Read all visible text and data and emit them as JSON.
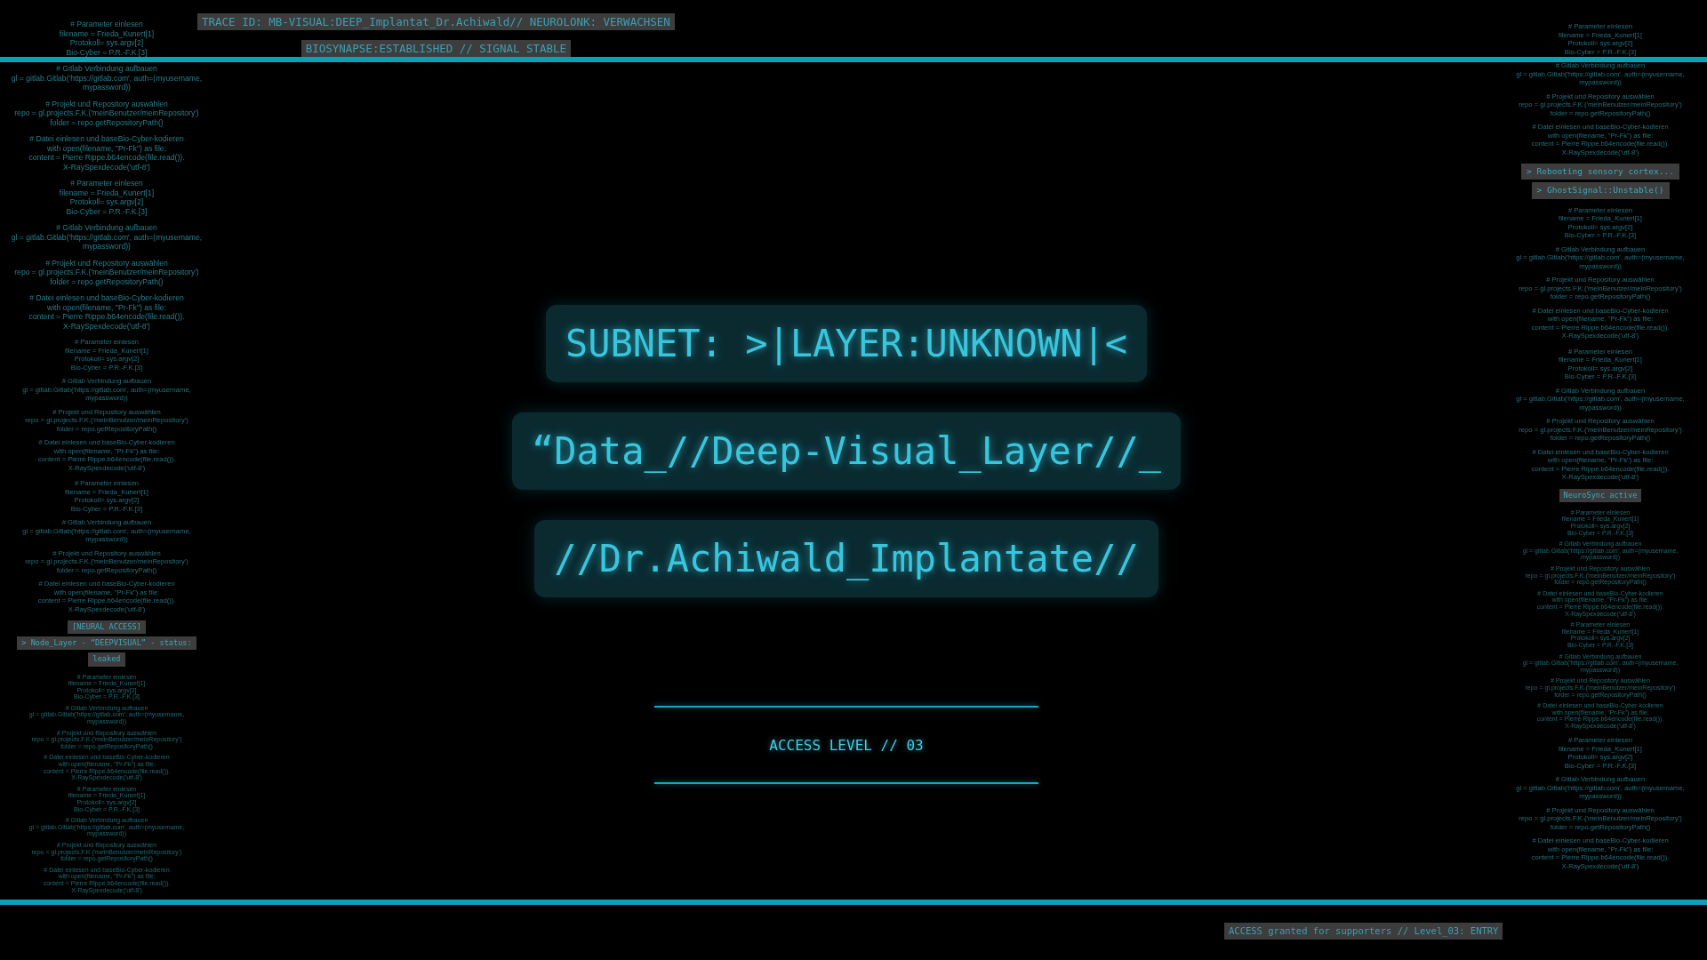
{
  "top_labels": [
    "TRACE ID: MB-VISUAL:DEEP_Implantat_Dr.Achiwald// NEUROLONK: VERWACHSEN",
    "BIOSYNAPSE:ESTABLISHED // SIGNAL STABLE"
  ],
  "left_column": [
    {
      "kind": "code-large",
      "paragraphs": [
        "# Parameter einlesen\nfilename = Frieda_Kunert[1]\nProtokoll= sys.argv[2]\nBio-Cyber = P.R.-F.K.[3]",
        "# Gitlab Verbindung aufbauen\ngl = gitlab.Gitlab('https://gitlab.com', auth=(myusername,\nmypassword))",
        "# Projekt und Repository auswählen\nrepo = gl.projects.F.K.('meinBenutzer/meinRepository')\nfolder = repo.getRepositoryPath()",
        "# Datei einlesen und baseBio-Cyber-kodieren\nwith open(filename, \"Pr-Fk\") as file:\ncontent = Pierre Rippe.b64encode(file.read()).\nX-RaySpexdecode('utf-8')"
      ]
    },
    {
      "kind": "code-large",
      "paragraphs": [
        "# Parameter einlesen\nfilename = Frieda_Kunert[1]\nProtokoll= sys.argv[2]\nBio-Cyber = P.R.-F.K.[3]",
        "# Gitlab Verbindung aufbauen\ngl = gitlab.Gitlab('https://gitlab.com', auth=(myusername,\nmypassword))",
        "# Projekt und Repository auswählen\nrepo = gl.projects.F.K.('meinBenutzer/meinRepository')\nfolder = repo.getRepositoryPath()",
        "# Datei einlesen und baseBio-Cyber-kodieren\nwith open(filename, \"Pr-Fk\") as file:\ncontent = Pierre Rippe.b64encode(file.read()).\nX-RaySpexdecode('utf-8')"
      ]
    },
    {
      "kind": "code-small",
      "paragraphs": [
        "# Parameter einlesen\nfilename = Frieda_Kunert[1]\nProtokoll= sys.argv[2]\nBio-Cyber = P.R.-F.K.[3]",
        "# Gitlab Verbindung aufbauen\ngl = gitlab.Gitlab('https://gitlab.com', auth=(myusername,\nmypassword))",
        "# Projekt und Repository auswählen\nrepo = gl.projects.F.K.('meinBenutzer/meinRepository')\nfolder = repo.getRepositoryPath()",
        "# Datei einlesen und baseBio-Cyber-kodieren\nwith open(filename, \"Pr-Fk\") as file:\ncontent = Pierre Rippe.b64encode(file.read()).\nX-RaySpexdecode('utf-8')"
      ]
    },
    {
      "kind": "code-small",
      "paragraphs": [
        "# Parameter einlesen\nfilename = Frieda_Kunert[1]\nProtokoll= sys.argv[2]\nBio-Cyber = P.R.-F.K.[3]",
        "# Gitlab Verbindung aufbauen\ngl = gitlab.Gitlab('https://gitlab.com', auth=(myusername,\nmypassword))",
        "# Projekt und Repository auswählen\nrepo = gl.projects.F.K.('meinBenutzer/meinRepository')\nfolder = repo.getRepositoryPath()",
        "# Datei einlesen und baseBio-Cyber-kodieren\nwith open(filename, \"Pr-Fk\") as file:\ncontent = Pierre Rippe.b64encode(file.read()).\nX-RaySpexdecode('utf-8')"
      ]
    },
    {
      "kind": "tags-small",
      "lines": [
        "[NEURAL ACCESS]",
        "> Node_Layer - “DEEPVISUAL” - status:",
        "leaked"
      ]
    },
    {
      "kind": "code-tiny",
      "paragraphs": [
        "# Parameter einlesen\nfilename = Frieda_Kunert[1]\nProtokoll= sys.argv[2]\nBio-Cyber = P.R.-F.K.[3]",
        "# Gitlab Verbindung aufbauen\ngl = gitlab.Gitlab('https://gitlab.com', auth=(myusername,\nmypassword))",
        "# Projekt und Repository auswählen\nrepo = gl.projects.F.K.('meinBenutzer/meinRepository')\nfolder = repo.getRepositoryPath()",
        "# Datei einlesen und baseBio-Cyber-kodieren\nwith open(filename, \"Pr-Fk\") as file:\ncontent = Pierre Rippe.b64encode(file.read()).\nX-RaySpexdecode('utf-8')",
        "# Parameter einlesen\nfilename = Frieda_Kunert[1]\nProtokoll= sys.argv[2]\nBio-Cyber = P.R.-F.K.[3]",
        "# Gitlab Verbindung aufbauen\ngl = gitlab.Gitlab('https://gitlab.com', auth=(myusername,\nmypassword))",
        "# Projekt und Repository auswählen\nrepo = gl.projects.F.K.('meinBenutzer/meinRepository')\nfolder = repo.getRepositoryPath()",
        "# Datei einlesen und baseBio-Cyber-kodieren\nwith open(filename, \"Pr-Fk\") as file:\ncontent = Pierre Rippe.b64encode(file.read()).\nX-RaySpexdecode('utf-8')"
      ]
    }
  ],
  "center": {
    "title_lines": [
      "SUBNET: >|LAYER:UNKNOWN|<",
      "“Data_//Deep-Visual_Layer//_",
      "//Dr.Achiwald_Implantate//"
    ],
    "access_level": "ACCESS LEVEL // 03"
  },
  "right_column": [
    {
      "kind": "code-small",
      "paragraphs": [
        "# Parameter einlesen\nfilename = Frieda_Kunert[1]\nProtokoll= sys.argv[2]\nBio-Cyber = P.R.-F.K.[3]",
        "# Gitlab Verbindung aufbauen\ngl = gitlab.Gitlab('https://gitlab.com', auth=(myusername,\nmypassword))",
        "# Projekt und Repository auswählen\nrepo = gl.projects.F.K.('meinBenutzer/meinRepository')\nfolder = repo.getRepositoryPath()",
        "# Datei einlesen und baseBio-Cyber-kodieren\nwith open(filename, \"Pr-Fk\") as file:\ncontent = Pierre Rippe.b64encode(file.read()).\nX-RaySpexdecode('utf-8')"
      ]
    },
    {
      "kind": "tags-large",
      "lines": [
        "> Rebooting sensory cortex...",
        "> GhostSignal::Unstable()"
      ]
    },
    {
      "kind": "code-small",
      "paragraphs": [
        "# Parameter einlesen\nfilename = Frieda_Kunert[1]\nProtokoll= sys.argv[2]\nBio-Cyber = P.R.-F.K.[3]",
        "# Gitlab Verbindung aufbauen\ngl = gitlab.Gitlab('https://gitlab.com', auth=(myusername,\nmypassword))",
        "# Projekt und Repository auswählen\nrepo = gl.projects.F.K.('meinBenutzer/meinRepository')\nfolder = repo.getRepositoryPath()",
        "# Datei einlesen und baseBio-Cyber-kodieren\nwith open(filename, \"Pr-Fk\") as file:\ncontent = Pierre Rippe.b64encode(file.read()).\nX-RaySpexdecode('utf-8')"
      ]
    },
    {
      "kind": "code-small",
      "paragraphs": [
        "# Parameter einlesen\nfilename = Frieda_Kunert[1]\nProtokoll= sys.argv[2]\nBio-Cyber = P.R.-F.K.[3]",
        "# Gitlab Verbindung aufbauen\ngl = gitlab.Gitlab('https://gitlab.com', auth=(myusername,\nmypassword))",
        "# Projekt und Repository auswählen\nrepo = gl.projects.F.K.('meinBenutzer/meinRepository')\nfolder = repo.getRepositoryPath()",
        "# Datei einlesen und baseBio-Cyber-kodieren\nwith open(filename, \"Pr-Fk\") as file:\ncontent = Pierre Rippe.b64encode(file.read()).\nX-RaySpexdecode('utf-8')"
      ]
    },
    {
      "kind": "tags-small",
      "lines": [
        "NeuroSync active"
      ]
    },
    {
      "kind": "code-tiny",
      "paragraphs": [
        "# Parameter einlesen\nfilename = Frieda_Kunert[1]\nProtokoll= sys.argv[2]\nBio-Cyber = P.R.-F.K.[3]",
        "# Gitlab Verbindung aufbauen\ngl = gitlab.Gitlab('https://gitlab.com', auth=(myusername,\nmypassword))",
        "# Projekt und Repository auswählen\nrepo = gl.projects.F.K.('meinBenutzer/meinRepository')\nfolder = repo.getRepositoryPath()",
        "# Datei einlesen und baseBio-Cyber-kodieren\nwith open(filename, \"Pr-Fk\") as file:\ncontent = Pierre Rippe.b64encode(file.read()).\nX-RaySpexdecode('utf-8')",
        "# Parameter einlesen\nfilename = Frieda_Kunert[1]\nProtokoll= sys.argv[2]\nBio-Cyber = P.R.-F.K.[3]",
        "# Gitlab Verbindung aufbauen\ngl = gitlab.Gitlab('https://gitlab.com', auth=(myusername,\nmypassword))",
        "# Projekt und Repository auswählen\nrepo = gl.projects.F.K.('meinBenutzer/meinRepository')\nfolder = repo.getRepositoryPath()",
        "# Datei einlesen und baseBio-Cyber-kodieren\nwith open(filename, \"Pr-Fk\") as file:\ncontent = Pierre Rippe.b64encode(file.read()).\nX-RaySpexdecode('utf-8')"
      ]
    },
    {
      "kind": "code-small",
      "paragraphs": [
        "# Parameter einlesen\nfilename = Frieda_Kunert[1]\nProtokoll= sys.argv[2]\nBio-Cyber = P.R.-F.K.[3]",
        "# Gitlab Verbindung aufbauen\ngl = gitlab.Gitlab('https://gitlab.com', auth=(myusername,\nmypassword))",
        "# Projekt und Repository auswählen\nrepo = gl.projects.F.K.('meinBenutzer/meinRepository')\nfolder = repo.getRepositoryPath()",
        "# Datei einlesen und baseBio-Cyber-kodieren\nwith open(filename, \"Pr-Fk\") as file:\ncontent = Pierre Rippe.b64encode(file.read()).\nX-RaySpexdecode('utf-8')"
      ]
    }
  ],
  "bottom_label": "ACCESS granted for supporters // Level_03: ENTRY"
}
